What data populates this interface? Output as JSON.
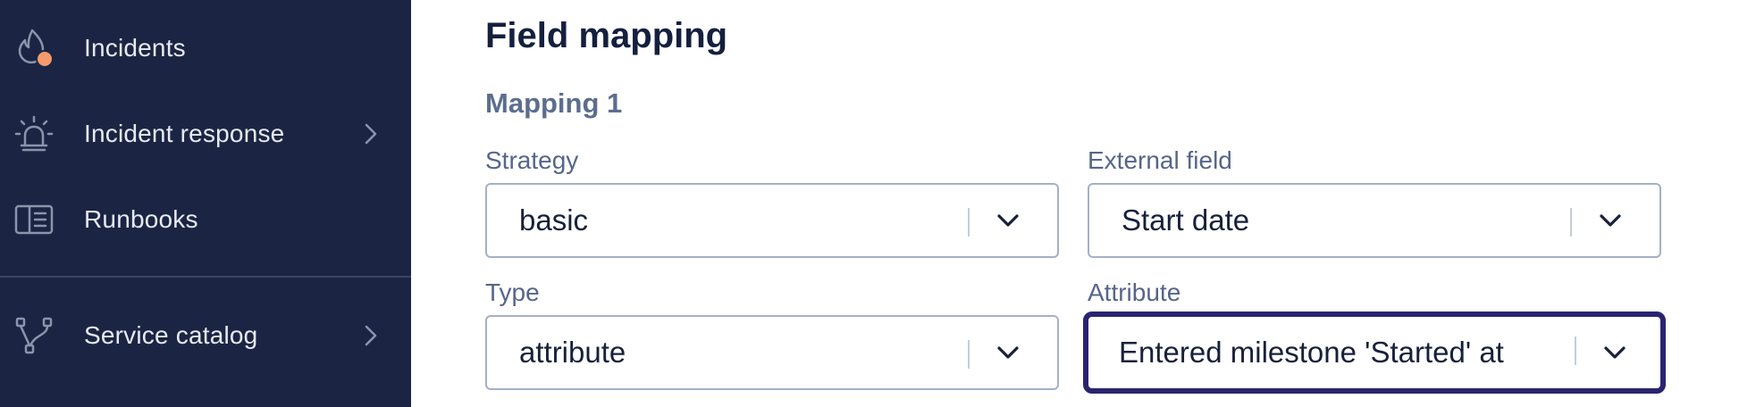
{
  "sidebar": {
    "items": [
      {
        "label": "Incidents",
        "icon": "flame-icon",
        "has_chevron": false,
        "badge_color": "#f49a6c"
      },
      {
        "label": "Incident response",
        "icon": "siren-icon",
        "has_chevron": true
      },
      {
        "label": "Runbooks",
        "icon": "book-icon",
        "has_chevron": false
      },
      {
        "label": "Service catalog",
        "icon": "branch-icon",
        "has_chevron": true
      }
    ]
  },
  "main": {
    "title": "Field mapping",
    "section_title": "Mapping 1",
    "fields": {
      "strategy": {
        "label": "Strategy",
        "value": "basic"
      },
      "external_field": {
        "label": "External field",
        "value": "Start date"
      },
      "type": {
        "label": "Type",
        "value": "attribute"
      },
      "attribute": {
        "label": "Attribute",
        "value": "Entered milestone 'Started' at"
      }
    }
  },
  "colors": {
    "sidebar_bg": "#1b2543",
    "focus_border": "#2a2470",
    "badge": "#f49a6c"
  }
}
